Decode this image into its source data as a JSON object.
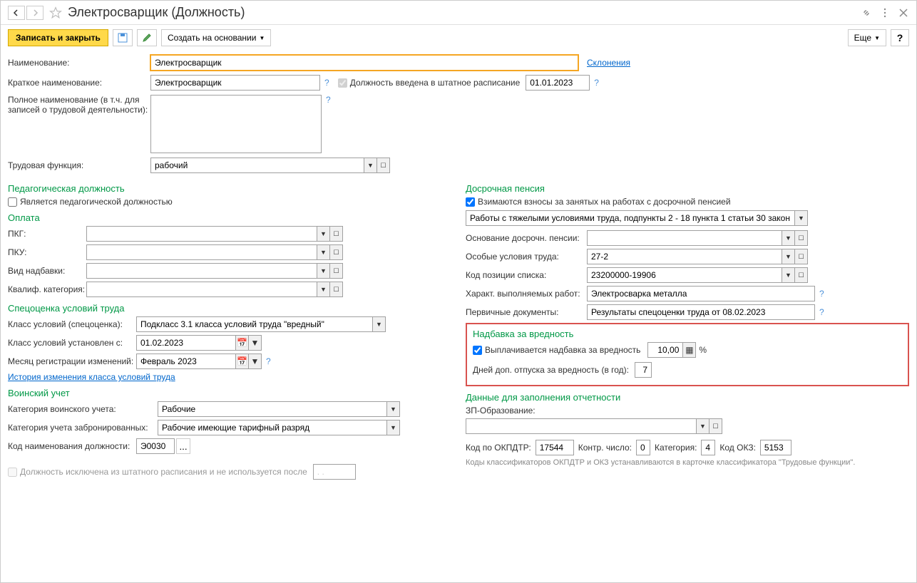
{
  "header": {
    "title": "Электросварщик (Должность)"
  },
  "toolbar": {
    "save_close": "Записать и закрыть",
    "create_based": "Создать на основании",
    "more": "Еще"
  },
  "form": {
    "name_label": "Наименование:",
    "name_value": "Электросварщик",
    "declension_link": "Склонения",
    "short_name_label": "Краткое наименование:",
    "short_name_value": "Электросварщик",
    "in_staff_label": "Должность введена в штатное расписание",
    "staff_date": "01.01.2023",
    "full_name_label": "Полное наименование (в т.ч. для записей о трудовой деятельности):",
    "labor_func_label": "Трудовая функция:",
    "labor_func_value": "рабочий"
  },
  "pedagog": {
    "title": "Педагогическая должность",
    "is_pedagog": "Является педагогической должностью"
  },
  "payment": {
    "title": "Оплата",
    "pkg": "ПКГ:",
    "pku": "ПКУ:",
    "allowance_type": "Вид надбавки:",
    "qualif": "Квалиф. категория:"
  },
  "spec": {
    "title": "Спецоценка условий труда",
    "class_label": "Класс условий (спецоценка):",
    "class_value": "Подкласс 3.1 класса условий труда \"вредный\"",
    "set_from_label": "Класс условий установлен с:",
    "set_from_value": "01.02.2023",
    "reg_month_label": "Месяц регистрации изменений:",
    "reg_month_value": "Февраль 2023",
    "history_link": "История изменения класса условий труда"
  },
  "military": {
    "title": "Воинский учет",
    "category_label": "Категория воинского учета:",
    "category_value": "Рабочие",
    "reserved_label": "Категория учета забронированных:",
    "reserved_value": "Рабочие имеющие тарифный разряд",
    "code_label": "Код наименования должности:",
    "code_value": "Э0030"
  },
  "excluded": {
    "label": "Должность исключена из штатного расписания и не используется после",
    "date": ". ."
  },
  "pension": {
    "title": "Досрочная пенсия",
    "contributions": "Взимаются взносы за занятых на работах с досрочной пенсией",
    "work_type": "Работы с тяжелыми условиями труда, подпункты 2 - 18 пункта 1 статьи 30 закон",
    "basis_label": "Основание досрочн. пенсии:",
    "conditions_label": "Особые условия труда:",
    "conditions_value": "27-2",
    "list_code_label": "Код позиции списка:",
    "list_code_value": "23200000-19906",
    "work_char_label": "Характ. выполняемых работ:",
    "work_char_value": "Электросварка металла",
    "docs_label": "Первичные документы:",
    "docs_value": "Результаты спецоценки труда от 08.02.2023"
  },
  "harm": {
    "title": "Надбавка за вредность",
    "paid_label": "Выплачивается надбавка за вредность",
    "percent": "10,00",
    "percent_sign": "%",
    "days_label": "Дней доп. отпуска за вредность (в год):",
    "days_value": "7"
  },
  "report": {
    "title": "Данные для заполнения отчетности",
    "zp_label": "ЗП-Образование:",
    "okpdtr_label": "Код по ОКПДТР:",
    "okpdtr_value": "17544",
    "control_label": "Контр. число:",
    "control_value": "0",
    "category_label": "Категория:",
    "category_value": "4",
    "okz_label": "Код ОКЗ:",
    "okz_value": "5153",
    "note": "Коды классификаторов ОКПДТР и ОКЗ устанавливаются в карточке классификатора \"Трудовые функции\"."
  }
}
